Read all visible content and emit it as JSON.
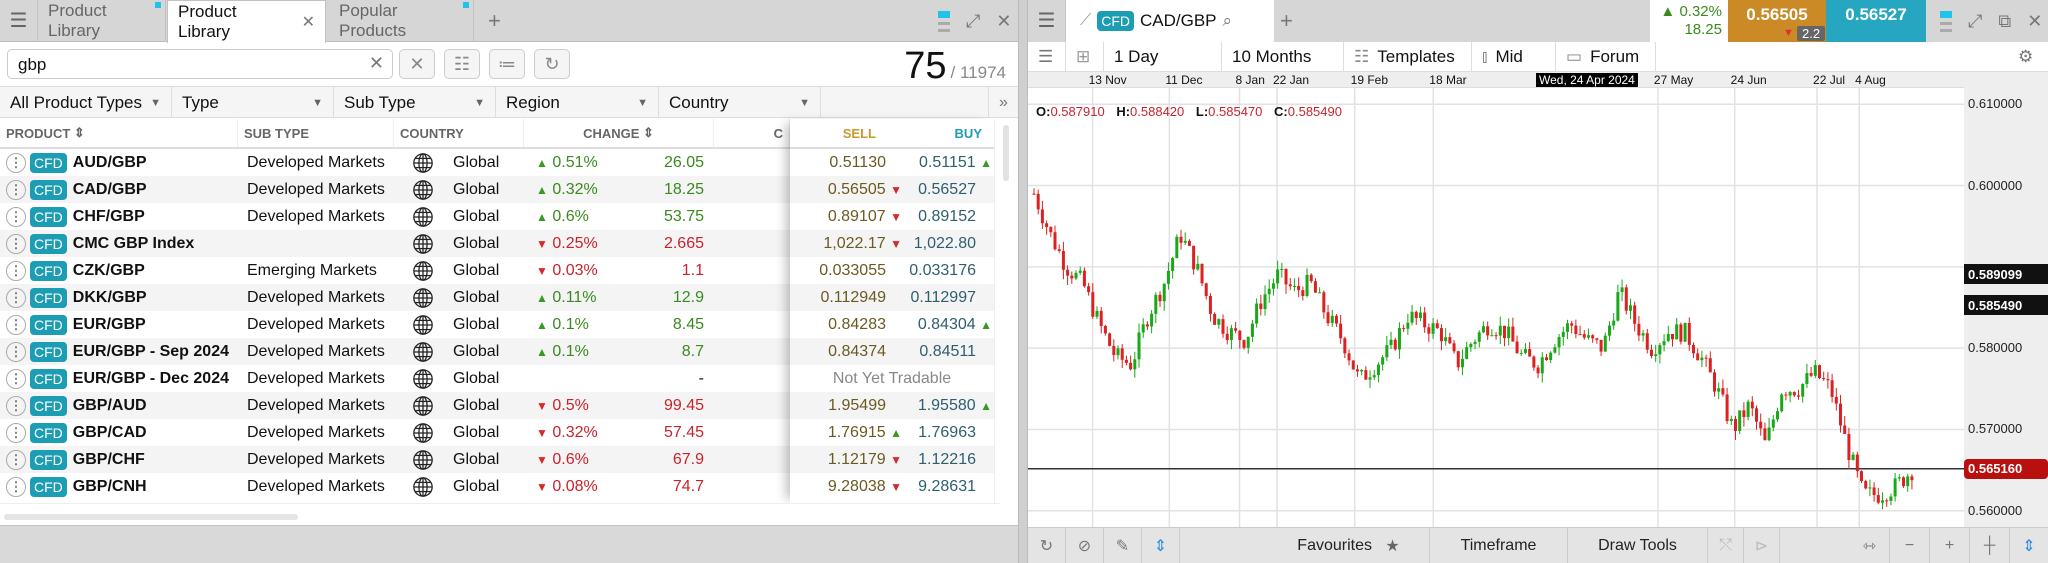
{
  "left": {
    "tabs": [
      {
        "label": "Product Library",
        "active": false,
        "dot": true
      },
      {
        "label": "Product Library",
        "active": true,
        "dot": false
      },
      {
        "label": "Popular Products",
        "active": false,
        "dot": true
      }
    ],
    "search": {
      "value": "gbp",
      "placeholder": ""
    },
    "count": {
      "shown": "75",
      "total": "/ 11974"
    },
    "filters": [
      "All Product Types",
      "Type",
      "Sub Type",
      "Region",
      "Country"
    ],
    "columns": {
      "product": "PRODUCT",
      "subtype": "SUB TYPE",
      "country": "COUNTRY",
      "change": "CHANGE",
      "cut": "C",
      "sell": "SELL",
      "buy": "BUY"
    },
    "rows": [
      {
        "badge": "CFD",
        "name": "AUD/GBP",
        "subtype": "Developed Markets",
        "country": "Global",
        "dir": "up",
        "pct": "0.51%",
        "pts": "26.05",
        "sell": "0.51130",
        "sell_tick": "",
        "buy": "0.51151",
        "buy_tick": "up"
      },
      {
        "badge": "CFD",
        "name": "CAD/GBP",
        "subtype": "Developed Markets",
        "country": "Global",
        "dir": "up",
        "pct": "0.32%",
        "pts": "18.25",
        "sell": "0.56505",
        "sell_tick": "dn",
        "buy": "0.56527",
        "buy_tick": ""
      },
      {
        "badge": "CFD",
        "name": "CHF/GBP",
        "subtype": "Developed Markets",
        "country": "Global",
        "dir": "up",
        "pct": "0.6%",
        "pts": "53.75",
        "sell": "0.89107",
        "sell_tick": "dn",
        "buy": "0.89152",
        "buy_tick": ""
      },
      {
        "badge": "CFD",
        "name": "CMC GBP Index",
        "subtype": "",
        "country": "Global",
        "dir": "dn",
        "pct": "0.25%",
        "pts": "2.665",
        "sell": "1,022.17",
        "sell_tick": "dn",
        "buy": "1,022.80",
        "buy_tick": ""
      },
      {
        "badge": "CFD",
        "name": "CZK/GBP",
        "subtype": "Emerging Markets",
        "country": "Global",
        "dir": "dn",
        "pct": "0.03%",
        "pts": "1.1",
        "sell": "0.033055",
        "sell_tick": "",
        "buy": "0.033176",
        "buy_tick": ""
      },
      {
        "badge": "CFD",
        "name": "DKK/GBP",
        "subtype": "Developed Markets",
        "country": "Global",
        "dir": "up",
        "pct": "0.11%",
        "pts": "12.9",
        "sell": "0.112949",
        "sell_tick": "",
        "buy": "0.112997",
        "buy_tick": ""
      },
      {
        "badge": "CFD",
        "name": "EUR/GBP",
        "subtype": "Developed Markets",
        "country": "Global",
        "dir": "up",
        "pct": "0.1%",
        "pts": "8.45",
        "sell": "0.84283",
        "sell_tick": "",
        "buy": "0.84304",
        "buy_tick": "up"
      },
      {
        "badge": "CFD",
        "name": "EUR/GBP - Sep 2024",
        "subtype": "Developed Markets",
        "country": "Global",
        "dir": "up",
        "pct": "0.1%",
        "pts": "8.7",
        "sell": "0.84374",
        "sell_tick": "",
        "buy": "0.84511",
        "buy_tick": ""
      },
      {
        "badge": "CFD",
        "name": "EUR/GBP - Dec 2024",
        "subtype": "Developed Markets",
        "country": "Global",
        "dir": "",
        "pct": "",
        "pts": "-",
        "status": "Not Yet Tradable"
      },
      {
        "badge": "CFD",
        "name": "GBP/AUD",
        "subtype": "Developed Markets",
        "country": "Global",
        "dir": "dn",
        "pct": "0.5%",
        "pts": "99.45",
        "sell": "1.95499",
        "sell_tick": "",
        "buy": "1.95580",
        "buy_tick": "up"
      },
      {
        "badge": "CFD",
        "name": "GBP/CAD",
        "subtype": "Developed Markets",
        "country": "Global",
        "dir": "dn",
        "pct": "0.32%",
        "pts": "57.45",
        "sell": "1.76915",
        "sell_tick": "up",
        "buy": "1.76963",
        "buy_tick": ""
      },
      {
        "badge": "CFD",
        "name": "GBP/CHF",
        "subtype": "Developed Markets",
        "country": "Global",
        "dir": "dn",
        "pct": "0.6%",
        "pts": "67.9",
        "sell": "1.12179",
        "sell_tick": "dn",
        "buy": "1.12216",
        "buy_tick": ""
      },
      {
        "badge": "CFD",
        "name": "GBP/CNH",
        "subtype": "Developed Markets",
        "country": "Global",
        "dir": "dn",
        "pct": "0.08%",
        "pts": "74.7",
        "sell": "9.28038",
        "sell_tick": "dn",
        "buy": "9.28631",
        "buy_tick": ""
      }
    ]
  },
  "right": {
    "tab": {
      "badge": "CFD",
      "instrument": "CAD/GBP"
    },
    "quote": {
      "change_pct": "0.32%",
      "change_pts": "18.25",
      "sell": "0.56505",
      "buy": "0.56527",
      "spread": "2.2"
    },
    "toolbar": {
      "interval": "1 Day",
      "range": "10 Months",
      "templates": "Templates",
      "price_type": "Mid",
      "forum": "Forum"
    },
    "footer": {
      "favourites": "Favourites",
      "timeframe": "Timeframe",
      "draw_tools": "Draw Tools"
    },
    "ohlc": {
      "o_label": "O:",
      "o": "0.587910",
      "h_label": "H:",
      "h": "0.588420",
      "l_label": "L:",
      "l": "0.585470",
      "c_label": "C:",
      "c": "0.585490"
    }
  },
  "chart_data": {
    "type": "candlestick",
    "title": "CAD/GBP",
    "x_ticks": [
      "13 Nov",
      "11 Dec",
      "8 Jan",
      "22 Jan",
      "19 Feb",
      "18 Mar",
      "27 May",
      "24 Jun",
      "22 Jul",
      "4 Aug"
    ],
    "hover_date": "Wed, 24 Apr 2024",
    "y_ticks": [
      "0.610000",
      "0.600000",
      "0.580000",
      "0.570000",
      "0.560000"
    ],
    "ylim": [
      0.558,
      0.612
    ],
    "price_labels": {
      "crosshair": "0.589099",
      "last_close": "0.585490",
      "current": "0.565160"
    },
    "current_price_line": 0.56516,
    "close_path": [
      0.599,
      0.594,
      0.59,
      0.588,
      0.583,
      0.579,
      0.578,
      0.584,
      0.588,
      0.594,
      0.59,
      0.584,
      0.582,
      0.581,
      0.586,
      0.589,
      0.587,
      0.588,
      0.584,
      0.581,
      0.576,
      0.578,
      0.58,
      0.584,
      0.583,
      0.582,
      0.578,
      0.581,
      0.583,
      0.582,
      0.579,
      0.578,
      0.581,
      0.583,
      0.581,
      0.58,
      0.587,
      0.583,
      0.58,
      0.582,
      0.582,
      0.579,
      0.575,
      0.57,
      0.573,
      0.568,
      0.575,
      0.575,
      0.577,
      0.575,
      0.568,
      0.562,
      0.562,
      0.563,
      0.565
    ]
  }
}
